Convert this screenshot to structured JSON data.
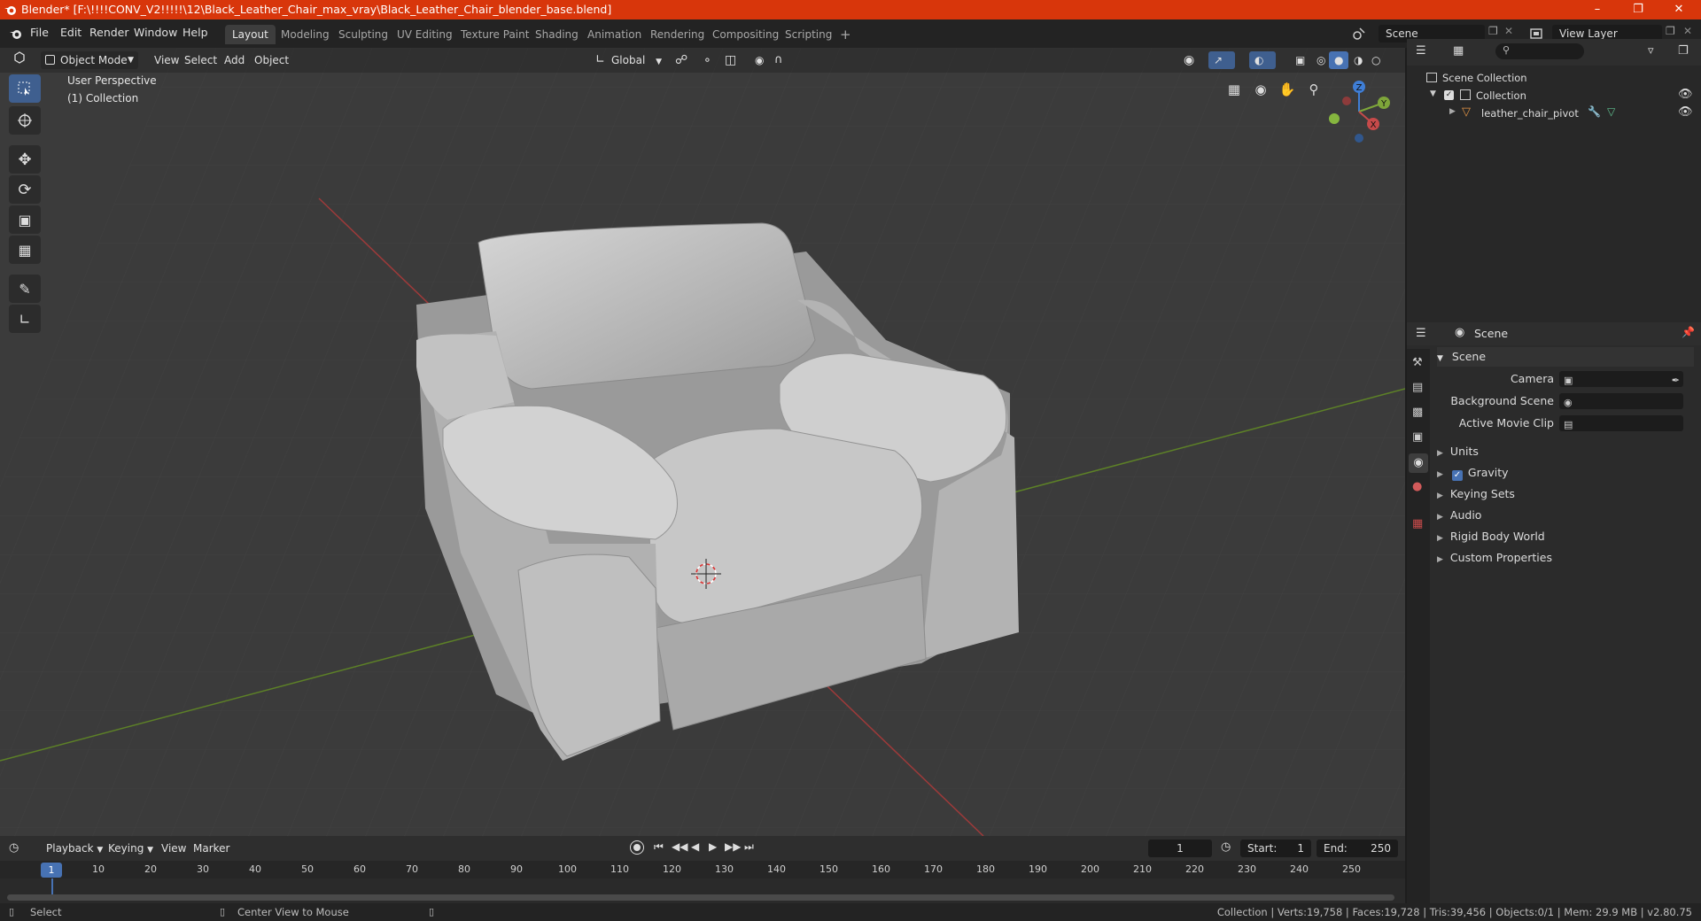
{
  "titlebar": {
    "title": "Blender* [F:\\!!!!CONV_V2!!!!!\\12\\Black_Leather_Chair_max_vray\\Black_Leather_Chair_blender_base.blend]"
  },
  "menubar": {
    "menus": [
      "File",
      "Edit",
      "Render",
      "Window",
      "Help"
    ],
    "workspaces": [
      "Layout",
      "Modeling",
      "Sculpting",
      "UV Editing",
      "Texture Paint",
      "Shading",
      "Animation",
      "Rendering",
      "Compositing",
      "Scripting"
    ],
    "active_workspace": "Layout",
    "scene_name": "Scene",
    "view_layer": "View Layer"
  },
  "viewport": {
    "mode": "Object Mode",
    "menus": [
      "View",
      "Select",
      "Add",
      "Object"
    ],
    "orientation": "Global",
    "perspective_label": "User Perspective",
    "collection_label": "(1) Collection",
    "gizmo_axes": [
      "Z",
      "Y",
      "X"
    ]
  },
  "outliner": {
    "scene_collection": "Scene Collection",
    "collection": "Collection",
    "object": "leather_chair_pivot"
  },
  "properties": {
    "header": "Scene",
    "section": "Scene",
    "fields": [
      {
        "label": "Camera"
      },
      {
        "label": "Background Scene"
      },
      {
        "label": "Active Movie Clip"
      }
    ],
    "subpanels": [
      "Units",
      "Gravity",
      "Keying Sets",
      "Audio",
      "Rigid Body World",
      "Custom Properties"
    ]
  },
  "timeline": {
    "menus": [
      "Playback",
      "Keying",
      "View",
      "Marker"
    ],
    "current_frame": "1",
    "start_label": "Start:",
    "start": "1",
    "end_label": "End:",
    "end": "250",
    "ruler": [
      "1",
      "10",
      "20",
      "30",
      "40",
      "50",
      "60",
      "70",
      "80",
      "90",
      "100",
      "110",
      "120",
      "130",
      "140",
      "150",
      "160",
      "170",
      "180",
      "190",
      "200",
      "210",
      "220",
      "230",
      "240",
      "250"
    ]
  },
  "statusbar": {
    "left": "Select",
    "middle": "Center View to Mouse",
    "stats": "Collection | Verts:19,758 | Faces:19,728 | Tris:39,456 | Objects:0/1 | Mem: 29.9 MB | v2.80.75"
  },
  "colors": {
    "title_bg": "#d8360b",
    "accent": "#4772b3",
    "x_axis": "#c64a4a",
    "y_axis": "#7ea63a",
    "z_axis": "#3f7ed6"
  }
}
